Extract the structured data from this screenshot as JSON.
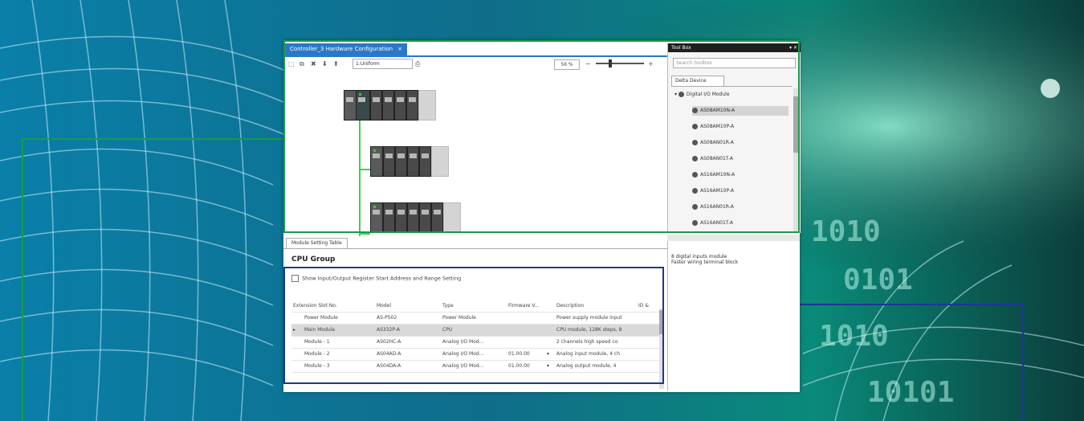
{
  "editor": {
    "tab_title": "Controller_3 Hardware Configuration",
    "tab_close": "×",
    "zoom_mode": "1:Uniform",
    "zoom_percent": "56 %"
  },
  "toolbox": {
    "title": "Tool Box",
    "controls": "▾ ✕",
    "search_placeholder": "Search toolbox",
    "tab": "Delta Device",
    "category": "Digital I/O Module",
    "items": [
      "AS08AM10N-A",
      "AS08AM10P-A",
      "AS08AN01R-A",
      "AS08AN01T-A",
      "AS16AM10N-A",
      "AS16AM10P-A",
      "AS16AN01R-A",
      "AS16AN01T-A"
    ],
    "description_line1": "8 digital inputs module",
    "description_line2": "Faster wiring terminal block"
  },
  "module_setting": {
    "tab": "Module Setting Table",
    "group_title": "CPU Group",
    "checkbox_label": "Show Input/Output Register Start Address and Range Setting",
    "columns": [
      "Extension Slot No.",
      "Model",
      "Type",
      "Firmware V...",
      "Description",
      "ID &"
    ],
    "rows": [
      {
        "marker": "",
        "slot": "Power Module",
        "model": "AS-PS02",
        "type": "Power Module",
        "fw": "",
        "desc": "Power supply module input"
      },
      {
        "marker": "▸",
        "slot": "Main Module",
        "model": "AS332P-A",
        "type": "CPU",
        "fw": "",
        "desc": "CPU module, 128K steps, 8"
      },
      {
        "marker": "",
        "slot": "Module - 1",
        "model": "AS02HC-A",
        "type": "Analog I/O Mod...",
        "fw": "",
        "desc": "2 channels high speed co"
      },
      {
        "marker": "",
        "slot": "Module - 2",
        "model": "AS04AD-A",
        "type": "Analog I/O Mod...",
        "fw": "01.00.00",
        "desc": "Analog input module, 4 ch"
      },
      {
        "marker": "",
        "slot": "Module - 3",
        "model": "AS04DA-A",
        "type": "Analog I/O Mod...",
        "fw": "01.00.00",
        "desc": "Analog output module, 4"
      }
    ]
  },
  "colors": {
    "accent_tab": "#2a78c8",
    "callout_green": "#1a9a4a",
    "callout_blue": "#1b3a8c"
  }
}
